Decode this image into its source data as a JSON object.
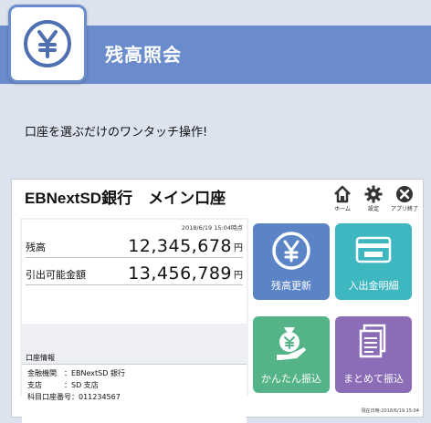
{
  "banner": {
    "title": "残高照会"
  },
  "tagline": "口座を選ぶだけのワンタッチ操作!",
  "app": {
    "title": "EBNextSD銀行　メイン口座",
    "top_icons": [
      {
        "icon": "home-icon",
        "label": "ホーム"
      },
      {
        "icon": "gear-icon",
        "label": "設定"
      },
      {
        "icon": "close-icon",
        "label": "アプリ終了"
      }
    ],
    "timestamp": "2018/6/19 15:04時点",
    "balance": {
      "label": "残高",
      "value": "12,345,678",
      "unit": "円"
    },
    "available": {
      "label": "引出可能金額",
      "value": "13,456,789",
      "unit": "円"
    },
    "account_info": {
      "title": "口座情報",
      "lines": [
        "金融機関　：EBNextSD 銀行",
        "支店　　　：SD 支店",
        "科目口座番号：011234567"
      ]
    },
    "buttons": [
      {
        "label": "残高更新",
        "icon": "yen-coin-icon",
        "color": "#5a84c6"
      },
      {
        "label": "入出金明細",
        "icon": "bank-card-icon",
        "color": "#3fb7c0"
      },
      {
        "label": "かんたん振込",
        "icon": "money-hand-icon",
        "color": "#55b487"
      },
      {
        "label": "まとめて振込",
        "icon": "documents-icon",
        "color": "#8a6db6"
      }
    ],
    "footer_timestamp": "現在日時:2018/6/19 15:04"
  }
}
